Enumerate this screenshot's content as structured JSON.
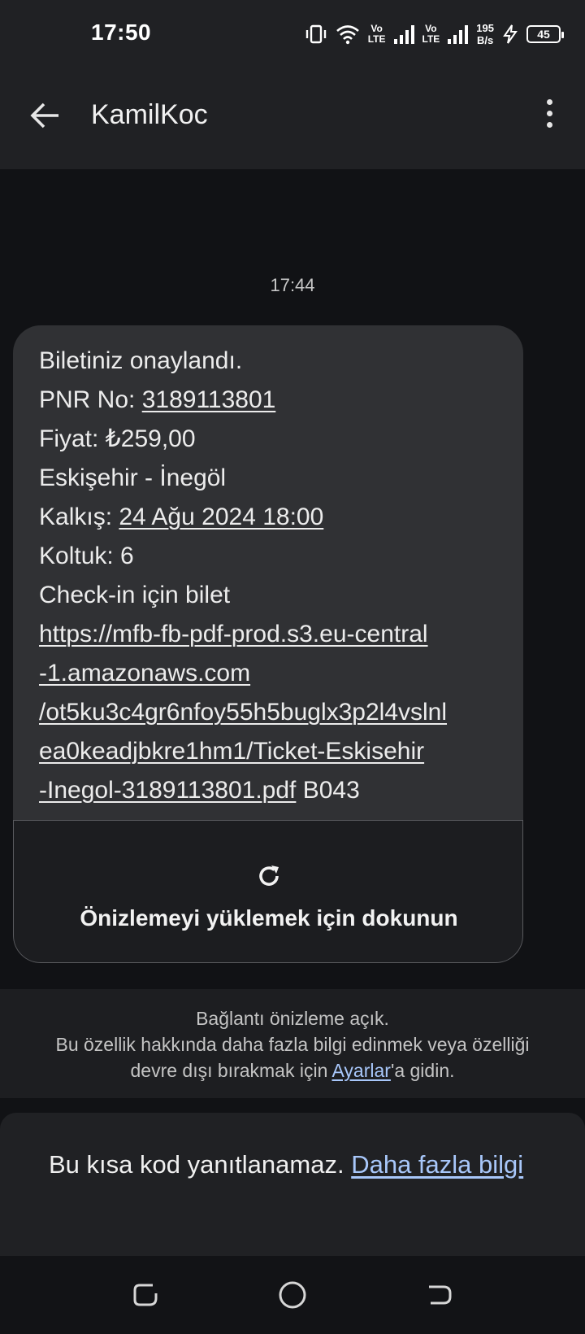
{
  "status_bar": {
    "time": "17:50",
    "sim1": {
      "top": "Vo",
      "bottom": "LTE"
    },
    "sim2": {
      "top": "Vo",
      "bottom": "LTE"
    },
    "speed_value": "195",
    "speed_unit": "B/s",
    "battery": "45",
    "icons": [
      "vibrate-icon",
      "wifi-icon",
      "signal-icon",
      "charging-icon",
      "battery-icon"
    ]
  },
  "app_bar": {
    "title": "KamilKoc",
    "icons": [
      "back-arrow-icon",
      "more-vert-icon"
    ]
  },
  "conversation": {
    "timestamp": "17:44",
    "message": {
      "line1": "Biletiniz onaylandı.",
      "pnr_label": "PNR No: ",
      "pnr_value": "3189113801",
      "price": "Fiyat: ₺259,00",
      "route": "Eskişehir - İnegöl",
      "departure_label": "Kalkış: ",
      "departure_value": "24 Ağu 2024 18:00",
      "seat": "Koltuk: 6",
      "checkin": "Check-in için bilet",
      "link_line1": "https://mfb-fb-pdf-prod.s3.eu-central",
      "link_line2": "-1.amazonaws.com",
      "link_line3": "/ot5ku3c4gr6nfoy55h5buglx3p2l4vslnl",
      "link_line4": "ea0keadjbkre1hm1/Ticket-Eskisehir",
      "link_line5": "-Inegol-3189113801.pdf",
      "suffix": " B043"
    },
    "preview": {
      "icon": "refresh-icon",
      "label": "Önizlemeyi yüklemek için dokunun"
    }
  },
  "link_preview_info": {
    "line1": "Bağlantı önizleme açık.",
    "line2": "Bu özellik hakkında daha fazla bilgi edinmek veya özelliği",
    "line3_before": "devre dışı bırakmak için ",
    "settings_link": "Ayarlar",
    "line3_after": "'a gidin."
  },
  "short_code": {
    "text": "Bu kısa kod yanıtlanamaz. ",
    "link": "Daha fazla bilgi"
  },
  "nav_bar": {
    "icons": [
      "recent-apps-icon",
      "home-icon",
      "back-icon"
    ]
  }
}
